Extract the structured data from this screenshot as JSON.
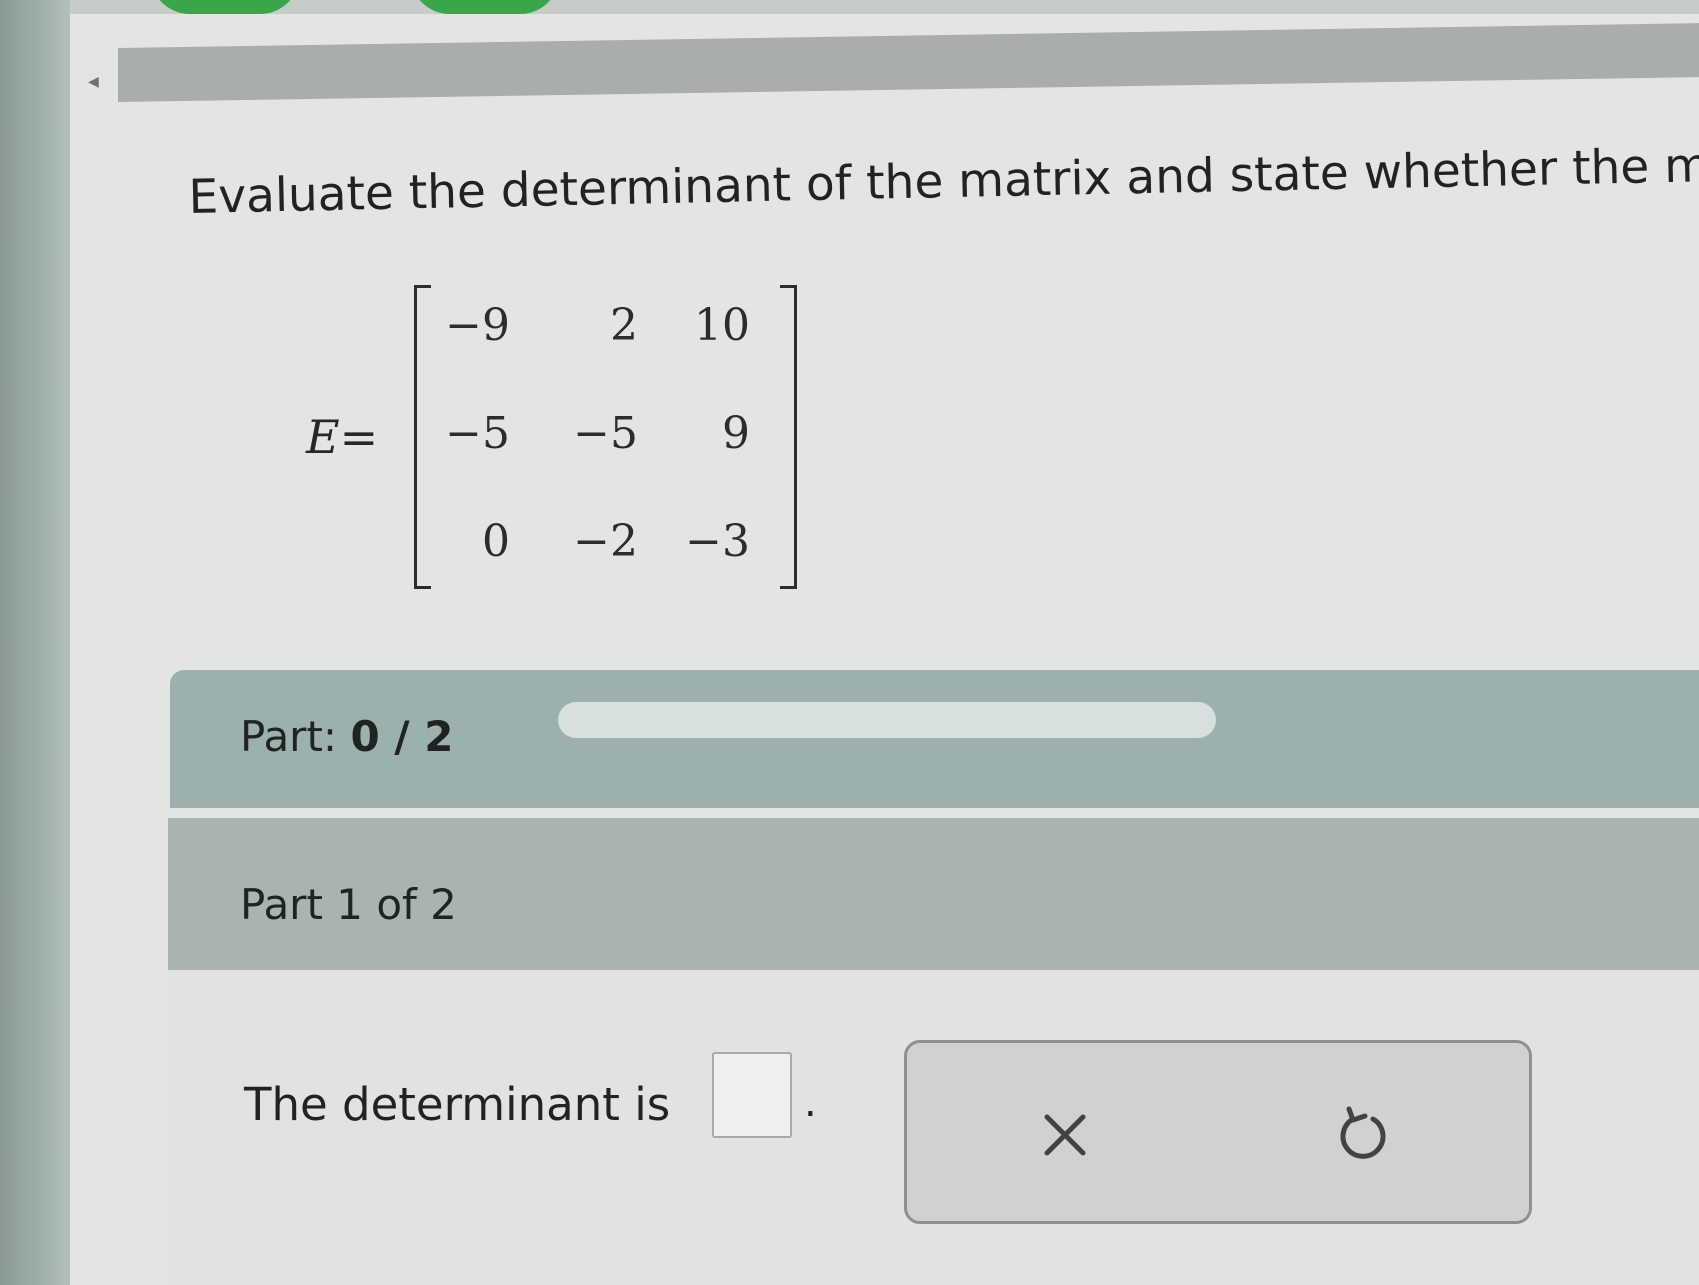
{
  "question": {
    "text": "Evaluate the determinant of the matrix and state whether the mat"
  },
  "matrix": {
    "name": "E",
    "equals": "=",
    "rows": [
      [
        "−9",
        "2",
        "10"
      ],
      [
        "−5",
        "−5",
        "9"
      ],
      [
        "0",
        "−2",
        "−3"
      ]
    ]
  },
  "progress": {
    "label": "Part:",
    "value": "0 / 2",
    "fraction": 0
  },
  "part_header": {
    "label": "Part 1 of 2"
  },
  "answer": {
    "prompt": "The determinant is",
    "value": "",
    "suffix": "."
  },
  "actions": {
    "clear_icon": "x-icon",
    "undo_icon": "undo-icon"
  },
  "colors": {
    "tab_green": "#3aa64a",
    "part_bar": "#9cb0ad",
    "part_header": "#a9b4b1"
  }
}
